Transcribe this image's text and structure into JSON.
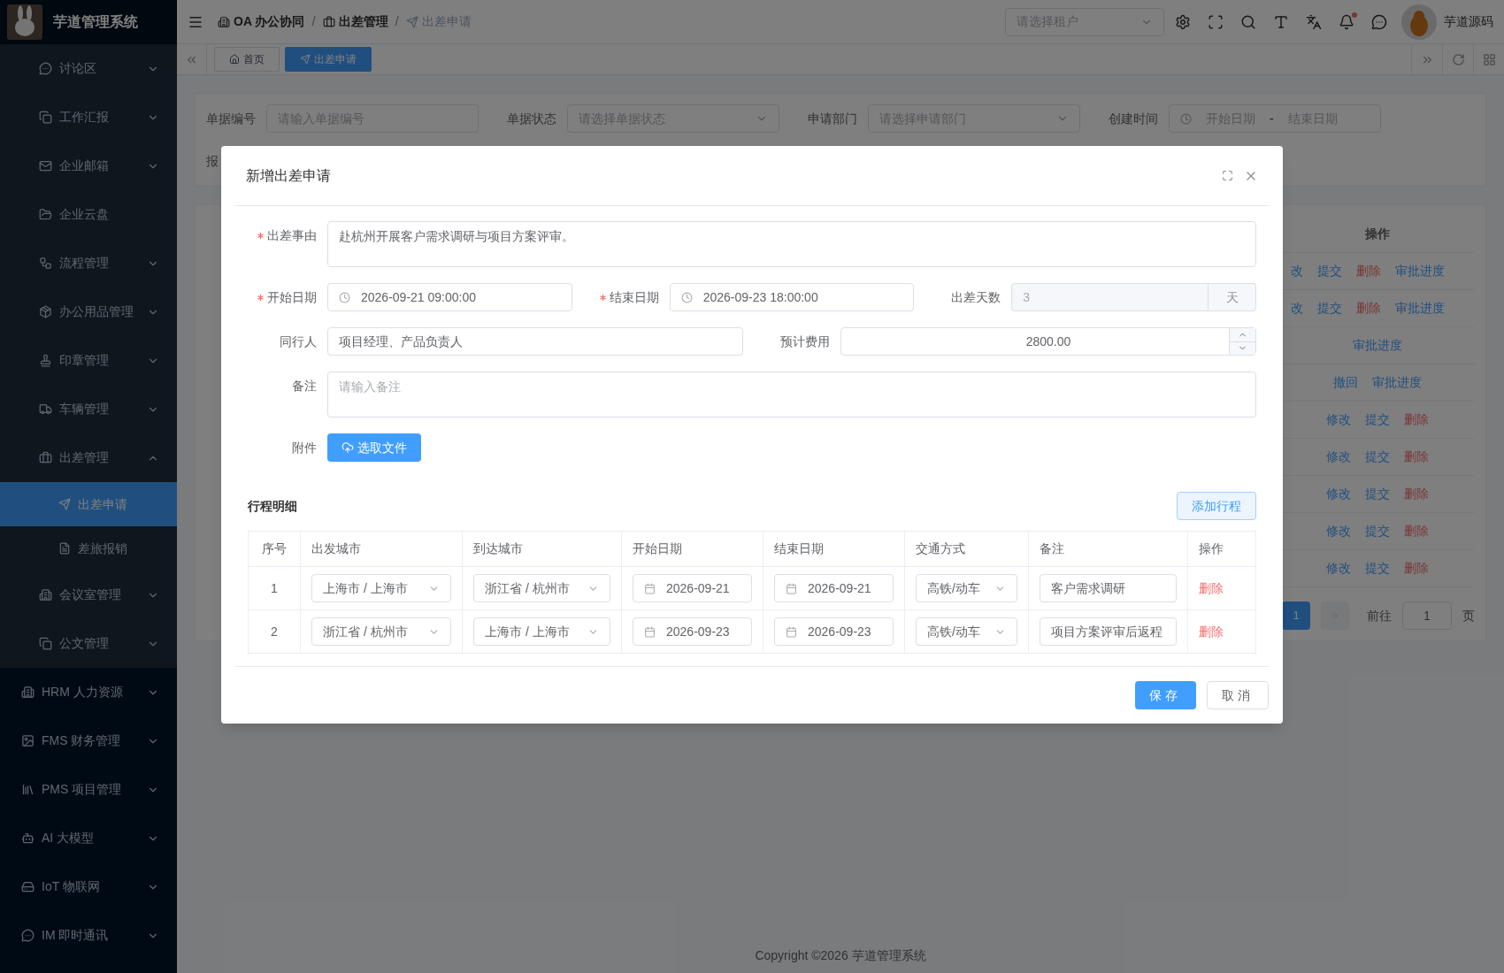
{
  "sidebar": {
    "logo_title": "芋道管理系统",
    "open_group_items": [
      {
        "label": "讨论区",
        "kind": "submenu",
        "expanded": false
      },
      {
        "label": "工作汇报",
        "kind": "submenu",
        "expanded": false
      },
      {
        "label": "企业邮箱",
        "kind": "submenu",
        "expanded": false
      },
      {
        "label": "企业云盘",
        "kind": "item"
      },
      {
        "label": "流程管理",
        "kind": "submenu",
        "expanded": false
      },
      {
        "label": "办公用品管理",
        "kind": "submenu",
        "expanded": false
      },
      {
        "label": "印章管理",
        "kind": "submenu",
        "expanded": false
      },
      {
        "label": "车辆管理",
        "kind": "submenu",
        "expanded": false
      },
      {
        "label": "出差管理",
        "kind": "submenu",
        "expanded": true,
        "children": [
          {
            "label": "出差申请",
            "selected": true
          },
          {
            "label": "差旅报销",
            "selected": false
          }
        ]
      },
      {
        "label": "会议室管理",
        "kind": "submenu",
        "expanded": false
      },
      {
        "label": "公文管理",
        "kind": "submenu",
        "expanded": false
      }
    ],
    "items": [
      {
        "label": "HRM 人力资源",
        "kind": "submenu",
        "expanded": false
      },
      {
        "label": "FMS 财务管理",
        "kind": "submenu",
        "expanded": false
      },
      {
        "label": "PMS 项目管理",
        "kind": "submenu",
        "expanded": false
      },
      {
        "label": "AI 大模型",
        "kind": "submenu",
        "expanded": false
      },
      {
        "label": "IoT 物联网",
        "kind": "submenu",
        "expanded": false
      },
      {
        "label": "IM 即时通讯",
        "kind": "submenu",
        "expanded": false
      }
    ]
  },
  "header": {
    "breadcrumbs": [
      {
        "label": "OA 办公协同",
        "current": false
      },
      {
        "label": "出差管理",
        "current": false
      },
      {
        "label": "出差申请",
        "current": true
      }
    ],
    "breadcrumb_separator": "/",
    "tenant_select": {
      "placeholder": "请选择租户"
    },
    "notifications_unread": true,
    "user_name": "芋道源码"
  },
  "tabs": [
    {
      "label": "首页",
      "selected": false
    },
    {
      "label": "出差申请",
      "selected": true
    }
  ],
  "search_form": {
    "fields": [
      {
        "label": "单据编号",
        "kind": "input",
        "placeholder": "请输入单据编号"
      },
      {
        "label": "单据状态",
        "kind": "select",
        "placeholder": "请选择单据状态"
      },
      {
        "label": "申请部门",
        "kind": "select",
        "placeholder": "请选择申请部门"
      },
      {
        "label": "创建时间",
        "kind": "daterange",
        "start_placeholder": "开始日期",
        "separator": "-",
        "end_placeholder": "结束日期"
      }
    ],
    "second_row_label": "报"
  },
  "table": {
    "action_header": "操作",
    "rows": [
      {
        "actions": [
          {
            "label": "改",
            "kind": "primary"
          },
          {
            "label": "提交",
            "kind": "primary"
          },
          {
            "label": "删除",
            "kind": "danger"
          },
          {
            "label": "审批进度",
            "kind": "primary"
          }
        ]
      },
      {
        "actions": [
          {
            "label": "改",
            "kind": "primary"
          },
          {
            "label": "提交",
            "kind": "primary"
          },
          {
            "label": "删除",
            "kind": "danger"
          },
          {
            "label": "审批进度",
            "kind": "primary"
          }
        ]
      },
      {
        "actions": [
          {
            "label": "审批进度",
            "kind": "primary"
          }
        ]
      },
      {
        "actions": [
          {
            "label": "撤回",
            "kind": "primary"
          },
          {
            "label": "审批进度",
            "kind": "primary"
          }
        ]
      },
      {
        "actions": [
          {
            "label": "修改",
            "kind": "primary"
          },
          {
            "label": "提交",
            "kind": "primary"
          },
          {
            "label": "删除",
            "kind": "danger"
          }
        ]
      },
      {
        "actions": [
          {
            "label": "修改",
            "kind": "primary"
          },
          {
            "label": "提交",
            "kind": "primary"
          },
          {
            "label": "删除",
            "kind": "danger"
          }
        ]
      },
      {
        "actions": [
          {
            "label": "修改",
            "kind": "primary"
          },
          {
            "label": "提交",
            "kind": "primary"
          },
          {
            "label": "删除",
            "kind": "danger"
          }
        ]
      },
      {
        "actions": [
          {
            "label": "修改",
            "kind": "primary"
          },
          {
            "label": "提交",
            "kind": "primary"
          },
          {
            "label": "删除",
            "kind": "danger"
          }
        ]
      },
      {
        "actions": [
          {
            "label": "修改",
            "kind": "primary"
          },
          {
            "label": "提交",
            "kind": "primary"
          },
          {
            "label": "删除",
            "kind": "danger"
          }
        ]
      }
    ],
    "pagination": {
      "current_page": "1",
      "goto_label": "前往",
      "goto_value": "1",
      "goto_suffix": "页"
    }
  },
  "footer": "Copyright ©2026 芋道管理系统",
  "dialog": {
    "title": "新增出差申请",
    "form_rows": [
      {
        "fields": [
          {
            "label": "出差事由",
            "required": true,
            "kind": "textarea",
            "value": "赴杭州开展客户需求调研与项目方案评审。"
          }
        ]
      },
      {
        "fields": [
          {
            "label": "开始日期",
            "required": true,
            "kind": "datetime",
            "value": "2026-09-21 09:00:00"
          },
          {
            "label": "结束日期",
            "required": true,
            "kind": "datetime",
            "value": "2026-09-23 18:00:00"
          },
          {
            "label": "出差天数",
            "required": false,
            "kind": "append",
            "value": "3",
            "append": "天",
            "disabled": true
          }
        ]
      },
      {
        "fields": [
          {
            "label": "同行人",
            "required": false,
            "kind": "text",
            "value": "项目经理、产品负责人"
          },
          {
            "label": "预计费用",
            "required": false,
            "kind": "number",
            "value": "2800.00"
          }
        ]
      },
      {
        "fields": [
          {
            "label": "备注",
            "required": false,
            "kind": "textarea",
            "placeholder": "请输入备注"
          }
        ]
      },
      {
        "fields": [
          {
            "label": "附件",
            "required": false,
            "kind": "upload",
            "button": "选取文件"
          }
        ]
      }
    ],
    "itinerary": {
      "title": "行程明细",
      "add_button": "添加行程",
      "columns": [
        "序号",
        "出发城市",
        "到达城市",
        "开始日期",
        "结束日期",
        "交通方式",
        "备注",
        "操作"
      ],
      "rows": [
        {
          "index": "1",
          "from": "上海市 / 上海市",
          "to": "浙江省 / 杭州市",
          "start": "2026-09-21",
          "end": "2026-09-21",
          "transport": "高铁/动车",
          "note": "客户需求调研",
          "action": "删除"
        },
        {
          "index": "2",
          "from": "浙江省 / 杭州市",
          "to": "上海市 / 上海市",
          "start": "2026-09-23",
          "end": "2026-09-23",
          "transport": "高铁/动车",
          "note": "项目方案评审后返程",
          "action": "删除"
        }
      ]
    },
    "buttons": [
      {
        "label": "保存",
        "kind": "primary"
      },
      {
        "label": "取消",
        "kind": "default"
      }
    ]
  }
}
